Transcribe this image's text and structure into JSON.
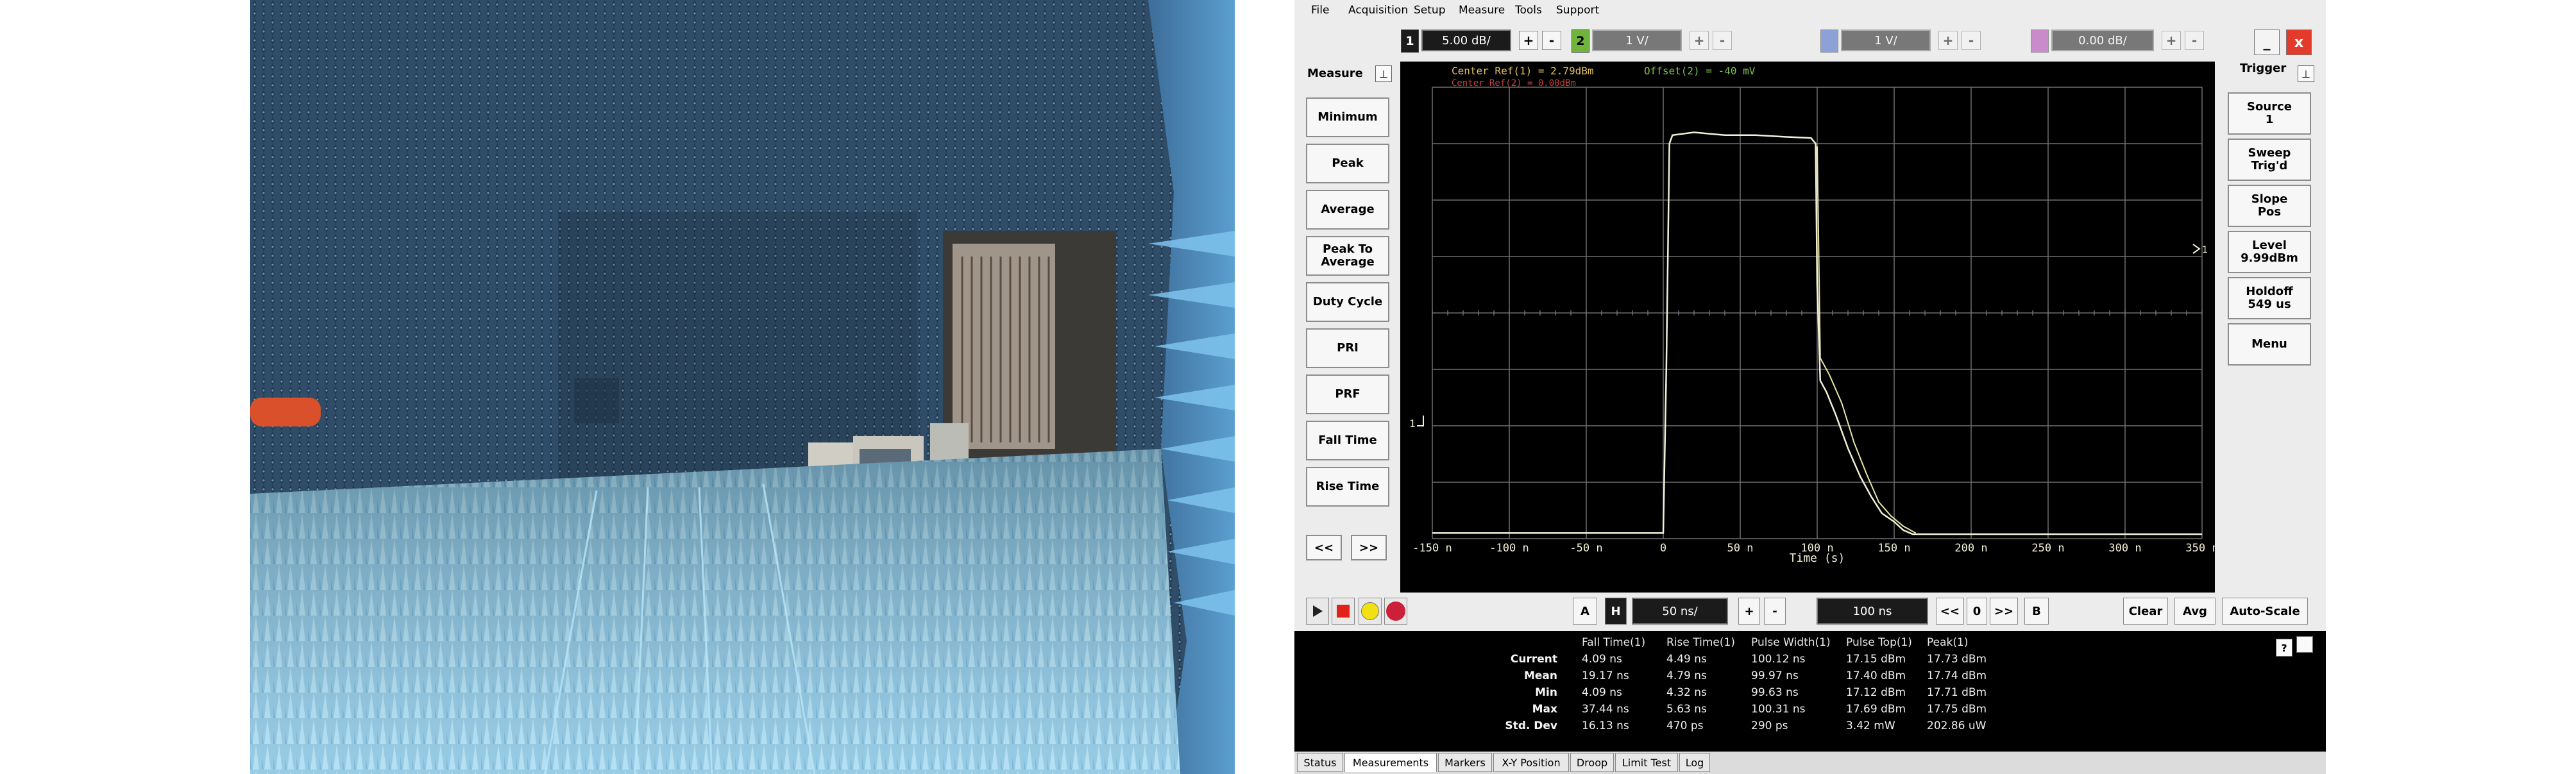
{
  "menu": [
    "File",
    "Acquisition",
    "Setup",
    "Measure",
    "Tools",
    "Support"
  ],
  "toolbar": {
    "ch1": {
      "num": "1",
      "value": "5.00 dB/"
    },
    "ch2": {
      "num": "2",
      "value": "1 V/"
    },
    "ch3": {
      "value": "1 V/"
    },
    "ch4": {
      "value": "0.00 dB/"
    },
    "plus": "+",
    "minus": "-"
  },
  "window_buttons": {
    "minimize": "_",
    "close": "x"
  },
  "measure_panel": {
    "title": "Measure",
    "buttons": [
      "Minimum",
      "Peak",
      "Average",
      "Peak To Average",
      "Duty Cycle",
      "PRI",
      "PRF",
      "Fall Time",
      "Rise Time"
    ],
    "prev": "<<",
    "next": ">>"
  },
  "trigger_panel": {
    "title": "Trigger",
    "buttons": [
      {
        "line1": "Source",
        "line2": "1"
      },
      {
        "line1": "Sweep",
        "line2": "Trig'd"
      },
      {
        "line1": "Slope",
        "line2": "Pos"
      },
      {
        "line1": "Level",
        "line2": "9.99dBm"
      },
      {
        "line1": "Holdoff",
        "line2": "549 us"
      },
      {
        "line1": "Menu",
        "line2": ""
      }
    ]
  },
  "scope": {
    "ref1": "Center Ref(1) = 2.79dBm",
    "offset2": "Offset(2) = -40 mV",
    "ref2": "Center Ref(2) = 0.00dBm",
    "ch1_marker": "1",
    "trig_marker": "1",
    "x_ticks": [
      "-150 n",
      "-100 n",
      "-50 n",
      "0",
      "50 n",
      "100 n",
      "150 n",
      "200 n",
      "250 n",
      "300 n",
      "350 n"
    ],
    "x_axis_label": "Time (s)",
    "colors": {
      "trace1": "#f2f0d8",
      "trace2": "#e9e7a6",
      "grid": "#6f6f6f",
      "ref1": "#e0c060",
      "offset2": "#7cc04a",
      "ref2": "#c84040"
    }
  },
  "controls": {
    "a_label": "A",
    "h_label": "H",
    "timebase": "50 ns/",
    "plus": "+",
    "minus": "-",
    "delay": "100 ns",
    "rew": "<<",
    "zero": "0",
    "fwd": ">>",
    "b_label": "B",
    "clear": "Clear",
    "avg": "Avg",
    "autoscale": "Auto-Scale"
  },
  "measurements": {
    "headers": [
      "Fall Time(1)",
      "Rise Time(1)",
      "Pulse Width(1)",
      "Pulse Top(1)",
      "Peak(1)"
    ],
    "rows": [
      {
        "label": "Current",
        "values": [
          "4.09 ns",
          "4.49 ns",
          "100.12 ns",
          "17.15 dBm",
          "17.73 dBm"
        ]
      },
      {
        "label": "Mean",
        "values": [
          "19.17 ns",
          "4.79 ns",
          "99.97 ns",
          "17.40 dBm",
          "17.74 dBm"
        ]
      },
      {
        "label": "Min",
        "values": [
          "4.09 ns",
          "4.32 ns",
          "99.63 ns",
          "17.12 dBm",
          "17.71 dBm"
        ]
      },
      {
        "label": "Max",
        "values": [
          "37.44 ns",
          "5.63 ns",
          "100.31 ns",
          "17.69 dBm",
          "17.75 dBm"
        ]
      },
      {
        "label": "Std. Dev",
        "values": [
          "16.13 ns",
          "470 ps",
          "290 ps",
          "3.42 mW",
          "202.86 uW"
        ]
      }
    ],
    "help": "?"
  },
  "tabs": [
    "Status",
    "Measurements",
    "Markers",
    "X-Y Position",
    "Droop",
    "Limit Test",
    "Log"
  ],
  "active_tab": "Measurements"
}
